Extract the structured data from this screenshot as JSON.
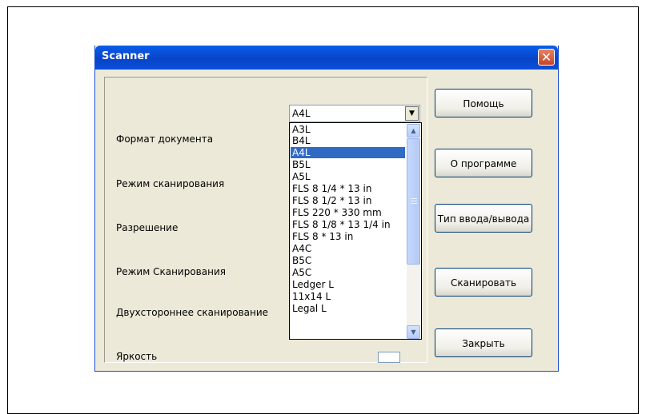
{
  "window": {
    "title": "Scanner",
    "close_label": "✕"
  },
  "form": {
    "labels": [
      "Формат документа",
      "Режим сканирования",
      "Разрешение",
      "Режим Сканирования",
      "Двухстороннее сканирование",
      "Яркость"
    ],
    "document_format": {
      "value": "A4L",
      "options": [
        "A3L",
        "B4L",
        "A4L",
        "B5L",
        "A5L",
        "FLS 8 1/4 * 13 in",
        "FLS 8 1/2 * 13 in",
        "FLS 220 * 330 mm",
        "FLS 8 1/8 * 13 1/4 in",
        "FLS 8 * 13 in",
        "A4C",
        "B5C",
        "A5C",
        "Ledger L",
        "11x14 L",
        "Legal L"
      ],
      "selected_option": "A4L"
    }
  },
  "buttons": {
    "help": "Помощь",
    "about": "О программе",
    "io_type": "Тип ввода/вывода",
    "scan": "Сканировать",
    "close": "Закрыть"
  },
  "icons": {
    "dropdown_arrow": "▼",
    "scroll_up": "▲",
    "scroll_down": "▼"
  }
}
